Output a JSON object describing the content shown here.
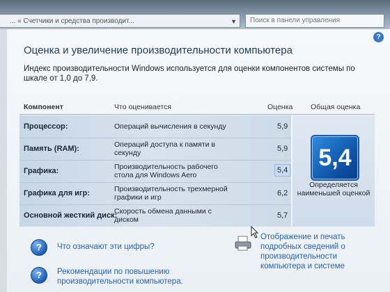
{
  "address_bar": {
    "text": "... « Счетчики и средства производит..."
  },
  "search": {
    "placeholder": "Поиск в панели управления"
  },
  "page": {
    "title": "Оценка и увеличение производительности компьютера",
    "description": "Индекс производительности Windows используется для оценки компонентов системы по шкале от 1,0 до 7,9."
  },
  "table": {
    "headers": {
      "component": "Компонент",
      "what": "Что оценивается",
      "score": "Оценка",
      "overall": "Общая оценка"
    },
    "rows": [
      {
        "component": "Процессор:",
        "what": "Операций вычисления в секунду",
        "score": "5,9"
      },
      {
        "component": "Память (RAM):",
        "what": "Операций доступа к памяти в секунду",
        "score": "5,9"
      },
      {
        "component": "Графика:",
        "what": "Производительность рабочего стола для Windows Aero",
        "score": "5,4"
      },
      {
        "component": "Графика для игр:",
        "what": "Производительность трехмерной графики и игр",
        "score": "6,2"
      },
      {
        "component": "Основной жесткий диск:",
        "what": "Скорость обмена данными с диском",
        "score": "5,7"
      }
    ],
    "overall": {
      "value": "5,4",
      "caption": "Определяется наименьшей оценкой"
    }
  },
  "links": {
    "what_numbers": "Что означают эти цифры?",
    "tips": "Рекомендации по повышению производительности компьютера.",
    "print": "Отображение и печать подробных сведений о производительности компьютера и системе"
  },
  "icons": {
    "help": "help-icon",
    "question": "question-icon",
    "printer": "printer-icon"
  }
}
